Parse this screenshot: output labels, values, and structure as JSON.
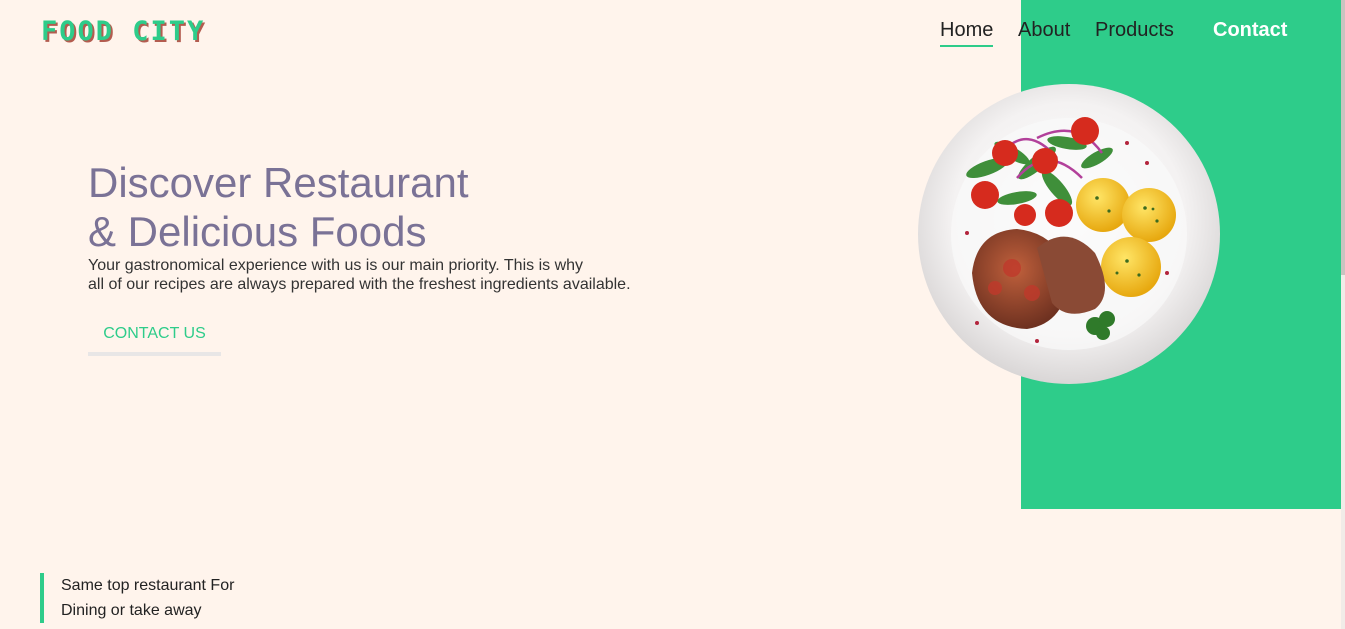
{
  "brand": {
    "logo_text": "FOOD CITY",
    "accent": "#2ecc8a"
  },
  "nav": {
    "home": "Home",
    "about": "About",
    "products": "Products",
    "contact": "Contact"
  },
  "hero": {
    "title_line1": "Discover Restaurant",
    "title_line2": "& Delicious Foods",
    "desc_line1": "Your gastronomical experience with us is our main priority. This is why",
    "desc_line2": "all of our recipes are always prepared with the freshest ingredients available.",
    "cta_label": "CONTACT US",
    "image_name": "food-plate-image"
  },
  "tagline": {
    "line1": "Same top restaurant For",
    "line2": "Dining or take away"
  }
}
